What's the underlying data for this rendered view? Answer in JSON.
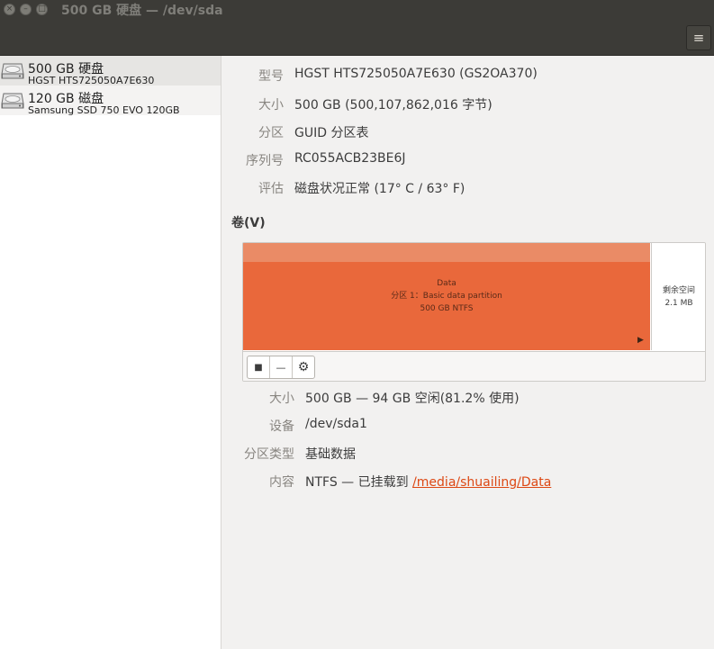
{
  "window": {
    "title": "500 GB 硬盘 — /dev/sda",
    "close_glyph": "×",
    "minimize_glyph": "–",
    "maximize_glyph": "□",
    "menu_glyph": "≡"
  },
  "sidebar": {
    "disks": [
      {
        "name": "500 GB 硬盘",
        "model": "HGST HTS725050A7E630",
        "selected": true
      },
      {
        "name": "120 GB 磁盘",
        "model": "Samsung SSD 750 EVO 120GB",
        "selected": false
      }
    ]
  },
  "drive": {
    "model_label": "型号",
    "model_value": "HGST HTS725050A7E630 (GS2OA370)",
    "size_label": "大小",
    "size_value": "500 GB (500,107,862,016 字节)",
    "partitioning_label": "分区",
    "partitioning_value": "GUID 分区表",
    "serial_label": "序列号",
    "serial_value": "RC055ACB23BE6J",
    "assessment_label": "评估",
    "assessment_value": "磁盘状况正常 (17° C / 63° F)"
  },
  "volumes": {
    "title": "卷(V)",
    "partition": {
      "name": "Data",
      "line2": "分区 1：Basic data partition",
      "line3": "500 GB NTFS",
      "arrow": "▶",
      "width_fraction": 0.881
    },
    "free_space": {
      "label": "剩余空间",
      "size": "2.1 MB"
    },
    "toolbar": {
      "stop_glyph": "■",
      "remove_glyph": "—",
      "settings_glyph": "⚙"
    }
  },
  "partition_details": {
    "size_label": "大小",
    "size_value": "500 GB — 94 GB 空闲(81.2% 使用)",
    "device_label": "设备",
    "device_value": "/dev/sda1",
    "type_label": "分区类型",
    "type_value": "基础数据",
    "contents_label": "内容",
    "contents_prefix": "NTFS — 已挂载到 ",
    "contents_link": "/media/shuailing/Data"
  },
  "colors": {
    "partition_fill": "#e9683b",
    "partition_top": "#ea8b66",
    "link": "#dd4814",
    "titlebar": "#3c3b37"
  }
}
